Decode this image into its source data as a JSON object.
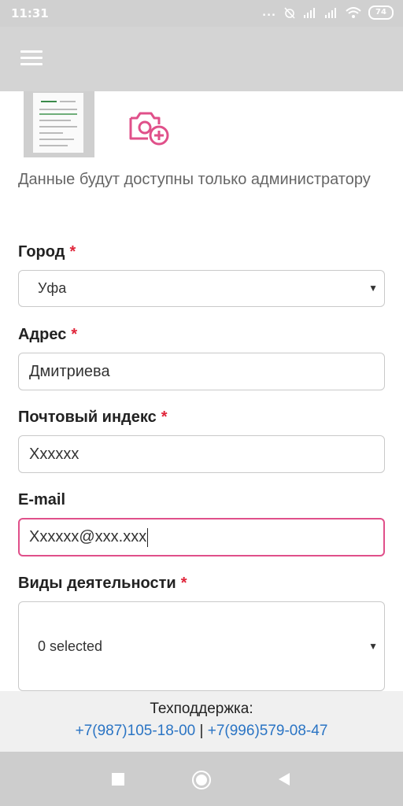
{
  "status_bar": {
    "time": "11:31",
    "dots": "...",
    "battery": "74",
    "icons": [
      "alarm-off-icon",
      "signal-icon",
      "signal-icon",
      "wifi-icon",
      "battery-icon"
    ]
  },
  "app_bar": {
    "menu_icon": "hamburger-menu-icon"
  },
  "photo": {
    "add_icon": "camera-add-icon",
    "accent": "#e0508a"
  },
  "note": "Данные будут доступны только администратору",
  "form": {
    "required_mark": "*",
    "city": {
      "label": "Город",
      "value": "Уфа"
    },
    "address": {
      "label": "Адрес",
      "value": "Дмитриева"
    },
    "postal": {
      "label": "Почтовый индекс",
      "value": "Xxxxxx"
    },
    "email": {
      "label": "E-mail",
      "value": "Xxxxxx@xxx.xxx"
    },
    "activities": {
      "label": "Виды деятельности",
      "value": "0 selected"
    }
  },
  "footer": {
    "title": "Техподдержка:",
    "phone1": "+7(987)105-18-00",
    "separator": "|",
    "phone2": "+7(996)579-08-47",
    "link_color": "#2a74c4"
  },
  "nav_bar": {
    "buttons": [
      "recent-apps-icon",
      "home-icon",
      "back-icon"
    ]
  }
}
